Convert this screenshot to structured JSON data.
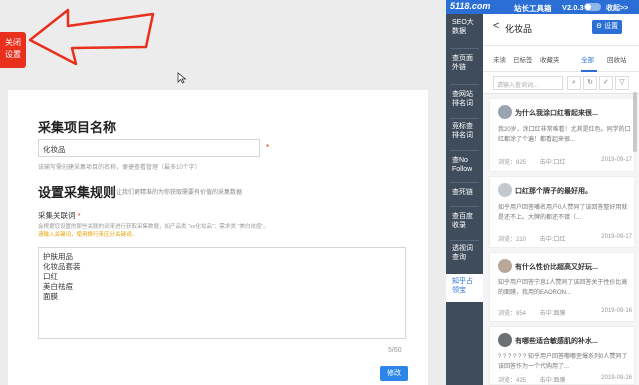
{
  "left": {
    "close_tab": [
      "关闭",
      "设置"
    ],
    "project_title": "采集项目名称",
    "project_name_value": "化妆品",
    "required_mark": "*",
    "project_hint": "该输写需创建采集项目的名称，便捷查看管理（最多10个字）",
    "rule_title": "设置采集规则",
    "rule_subtitle": "让我们更精准的为你获取需要有价值的采集数据",
    "keyword_label": "采集关联词",
    "keyword_desc": "会根据您设置的那些关联的词来进行获取采集数据，如产品类 \"xx化妆品\"：需求类 \"美白祛痘\"。",
    "keyword_warn": "请输入关键词，使用换行来区分关键词。",
    "keywords": [
      "护肤用品",
      "化妆品套装",
      "口红",
      "美白祛痘",
      "面膜"
    ],
    "counter": "5/60",
    "edit_button": "修改"
  },
  "toolbox": {
    "logo": "5118.com",
    "tool_name": "站长工具箱",
    "version": "V2.0.3",
    "collapse": "收起>>",
    "nav": [
      {
        "label": [
          "SEO大",
          "数据"
        ],
        "active": false
      },
      {
        "label": [
          "查页面",
          "外链"
        ],
        "active": false
      },
      {
        "label": [
          "查网站",
          "排名词"
        ],
        "active": false
      },
      {
        "label": [
          "竞标查",
          "排名词"
        ],
        "active": false
      },
      {
        "label": [
          "查No",
          "Follow"
        ],
        "active": false
      },
      {
        "label": [
          "查死链"
        ],
        "active": false
      },
      {
        "label": [
          "查百度",
          "收录"
        ],
        "active": false
      },
      {
        "label": [
          "透视词",
          "查询"
        ],
        "active": false
      },
      {
        "label": [
          "知乎占",
          "领宝"
        ],
        "active": true
      }
    ],
    "panel_title": "化妆品",
    "back": "<",
    "settings_button": "设置",
    "tabs": [
      "未读",
      "已标签",
      "收藏夹",
      "全部",
      "回收站"
    ],
    "active_tab": 3,
    "search_placeholder": "请输入查询词...",
    "icons": [
      "search-icon",
      "refresh-icon",
      "check-icon",
      "filter-icon"
    ],
    "questions": [
      {
        "title": "为什么我涂口红看起来很...",
        "text": "我20岁，涂口红非常难看！尤其是红色。同学的口红都涂了个遍！都看起来很...",
        "views": "浏览：825",
        "tag": "击中:口红",
        "date": "2019-09-17"
      },
      {
        "title": "口红那个牌子的最好用。",
        "text": "如乎用户回答嘴名用户0人赞同了该回答整好用就是还不上。大牌的都还不错（...",
        "views": "浏览：210",
        "tag": "击中:口红",
        "date": "2019-09-17"
      },
      {
        "title": "有什么性价比超高又好玩...",
        "text": "知乎用户回答宁息1人赞同了该回答关于性价比高的面膜，我用的EAORON...",
        "views": "浏览：854",
        "tag": "击中:面膜",
        "date": "2019-09-16"
      },
      {
        "title": "有哪些适合敏感肌的补水...",
        "text": "? ? ? ? ? ? 知乎用户回答嘟嘟歪爆系列0人赞同了该回答作为一个代购用了...",
        "views": "浏览：425",
        "tag": "击中:面膜",
        "date": "2019-09-16"
      }
    ]
  }
}
